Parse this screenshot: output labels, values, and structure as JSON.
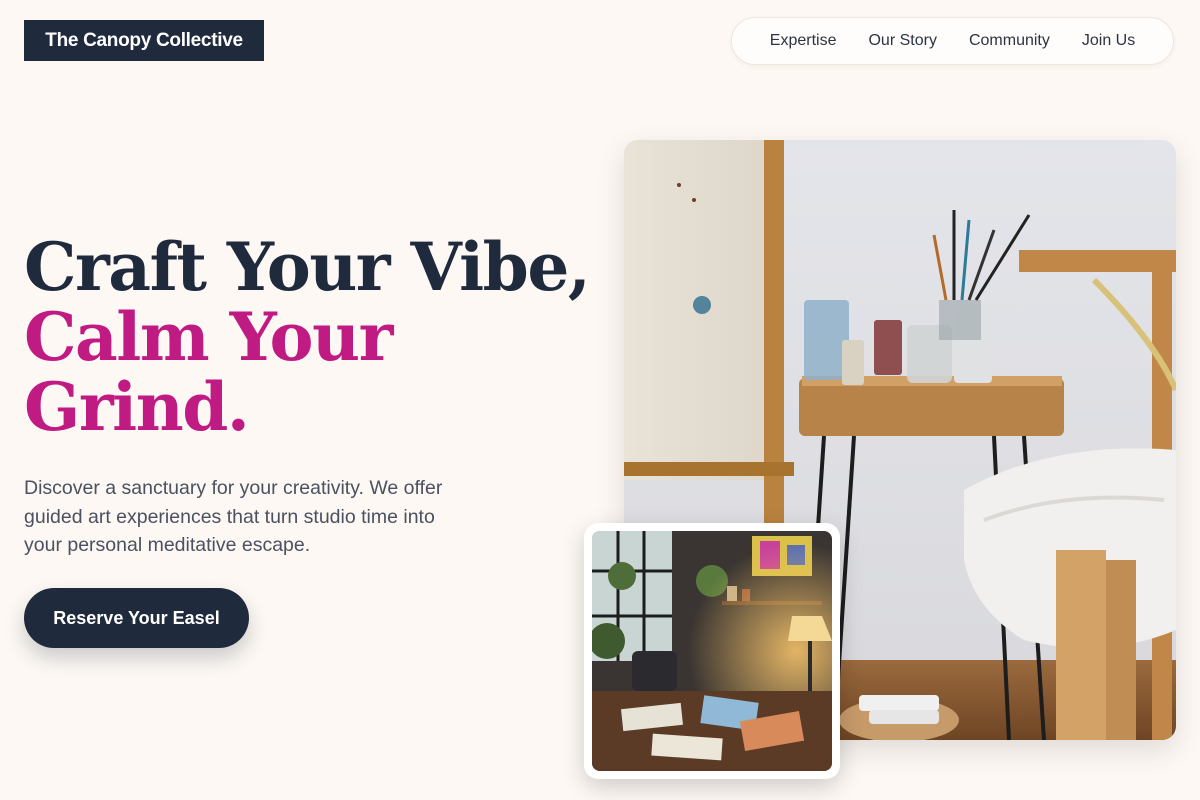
{
  "brand": {
    "name": "The Canopy Collective"
  },
  "nav": {
    "items": [
      {
        "label": "Expertise"
      },
      {
        "label": "Our Story"
      },
      {
        "label": "Community"
      },
      {
        "label": "Join Us"
      }
    ]
  },
  "hero": {
    "headline_line1": "Craft Your Vibe,",
    "headline_line2": "Calm Your",
    "headline_line3": "Grind.",
    "description": "Discover a sanctuary for your creativity. We offer guided art experiences that turn studio time into your personal meditative escape.",
    "cta_label": "Reserve Your Easel"
  },
  "colors": {
    "background": "#fdf8f3",
    "navy": "#1f2a3d",
    "accent_magenta": "#c01a83"
  },
  "images": {
    "main": "art-studio-easel-and-brushes-photo",
    "inset": "cozy-art-studio-room-photo"
  }
}
